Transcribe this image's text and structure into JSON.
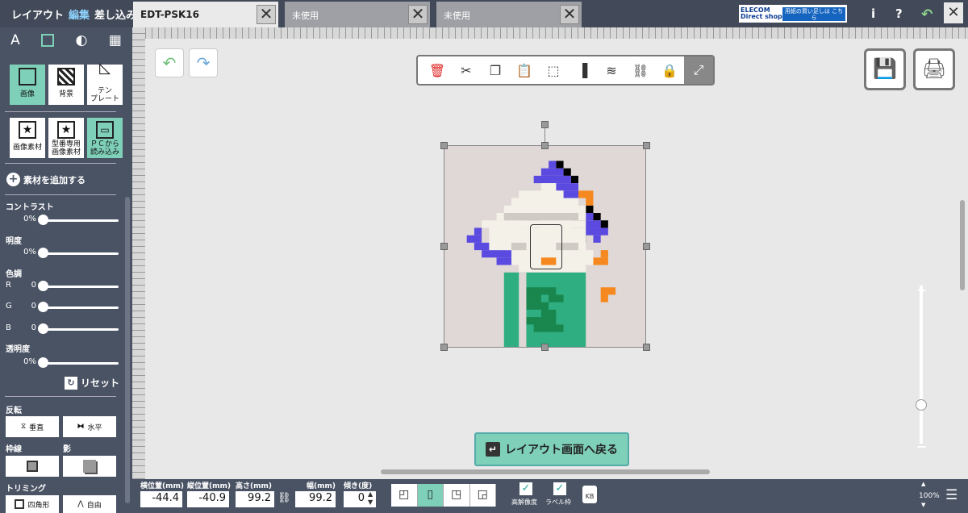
{
  "topnav": {
    "layout": "レイアウト",
    "edit": "編集",
    "insert": "差し込み"
  },
  "tabs": [
    {
      "label": "EDT-PSK16"
    },
    {
      "label": "未使用"
    },
    {
      "label": "未使用"
    }
  ],
  "elecom": {
    "brand": "ELECOM",
    "sub": "Direct shop",
    "cta": "用紙の買い足しは こちら"
  },
  "header_icons": {
    "info": "i",
    "help": "?",
    "back": "↶",
    "close": "✕"
  },
  "sidebar": {
    "tools": [
      "A",
      "image-tool-icon",
      "shape-tool-icon",
      "qr-tool-icon"
    ],
    "row1": [
      {
        "label": "画像"
      },
      {
        "label": "背景"
      },
      {
        "label": "テン\nプレート"
      }
    ],
    "row2": [
      {
        "label": "画像素材"
      },
      {
        "label": "型番専用\n画像素材"
      },
      {
        "label": "ＰＣから\n読み込み"
      }
    ],
    "add_material": "素材を追加する",
    "contrast_label": "コントラスト",
    "contrast_val": "0%",
    "brightness_label": "明度",
    "brightness_val": "0%",
    "color_label": "色調",
    "r_label": "R",
    "r_val": "0",
    "g_label": "G",
    "g_val": "0",
    "b_label": "B",
    "b_val": "0",
    "transparency_label": "透明度",
    "transparency_val": "0%",
    "reset": "リセット",
    "flip_label": "反転",
    "flip_vertical": "垂直",
    "flip_horizontal": "水平",
    "border_label": "枠線",
    "shadow_label": "影",
    "trim_label": "トリミング",
    "trim_square": "四角形",
    "trim_free": "自由"
  },
  "canvas": {
    "back_button": "レイアウト画面へ戻る",
    "zoom_plus": "+",
    "zoom_minus": "−"
  },
  "bottom": {
    "x_label": "横位置(mm)",
    "x_val": "-44.4",
    "y_label": "縦位置(mm)",
    "y_val": "-40.9",
    "h_label": "高さ(mm)",
    "h_val": "99.2",
    "w_label": "幅(mm)",
    "w_val": "99.2",
    "tilt_label": "傾き(度)",
    "tilt_val": "0",
    "hires_label": "高解像度",
    "labelframe_label": "ラベル枠",
    "weight": "KB",
    "zoom": "100%"
  }
}
